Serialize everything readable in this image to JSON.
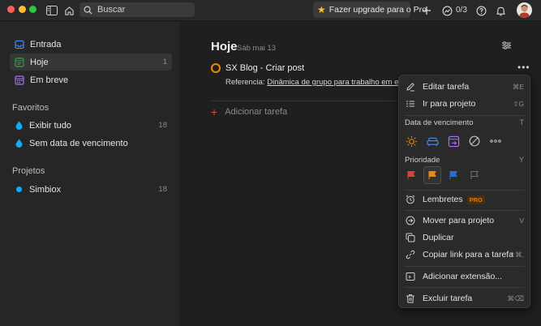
{
  "topbar": {
    "search_placeholder": "Buscar",
    "upgrade_label": "Fazer upgrade para o Pro",
    "karma_progress": "0/3",
    "icons": [
      "sidebar-toggle-icon",
      "home-icon",
      "search-icon",
      "star-icon",
      "plus-icon",
      "karma-icon",
      "help-icon",
      "bell-icon"
    ]
  },
  "sidebar": {
    "nav": [
      {
        "label": "Entrada",
        "count": "",
        "icon": "inbox-icon"
      },
      {
        "label": "Hoje",
        "count": "1",
        "icon": "today-icon"
      },
      {
        "label": "Em breve",
        "count": "",
        "icon": "upcoming-icon"
      }
    ],
    "favorites_title": "Favoritos",
    "favorites": [
      {
        "label": "Exibir tudo",
        "count": "18",
        "icon": "drop-icon"
      },
      {
        "label": "Sem data de vencimento",
        "count": "",
        "icon": "drop-icon"
      }
    ],
    "projects_title": "Projetos",
    "projects": [
      {
        "label": "Simbiox",
        "count": "18",
        "color": "#14aaf5"
      }
    ]
  },
  "main": {
    "title": "Hoje",
    "date": "Sáb mai 13",
    "task": {
      "title": "SX Blog - Criar post",
      "desc_prefix": "Referencia: ",
      "desc_link": "Dinâmica de grupo para trabalho em equipe.",
      "priority_color": "#eb8909"
    },
    "add_task_label": "Adicionar tarefa"
  },
  "menu": {
    "edit_label": "Editar tarefa",
    "edit_shortcut": "⌘E",
    "goto_label": "Ir para projeto",
    "goto_shortcut": "⇧G",
    "due_title": "Data de vencimento",
    "due_key": "T",
    "due_options": [
      "today-sun-icon",
      "tomorrow-sofa-icon",
      "next-week-icon",
      "no-date-icon",
      "more-dates-icon"
    ],
    "priority_title": "Prioridade",
    "priority_key": "Y",
    "priorities": [
      {
        "name": "p1-flag-icon",
        "color": "#d1453b"
      },
      {
        "name": "p2-flag-icon",
        "color": "#eb8909"
      },
      {
        "name": "p3-flag-icon",
        "color": "#246fe0"
      },
      {
        "name": "p4-flag-icon",
        "color": "#707070"
      }
    ],
    "reminders_label": "Lembretes",
    "pro_badge": "PRO",
    "move_label": "Mover para projeto",
    "move_shortcut": "V",
    "duplicate_label": "Duplicar",
    "copy_link_label": "Copiar link para a tarefa",
    "copy_link_shortcut": "⇧⌘,",
    "extension_label": "Adicionar extensão...",
    "delete_label": "Excluir tarefa",
    "delete_shortcut": "⌘⌫"
  }
}
